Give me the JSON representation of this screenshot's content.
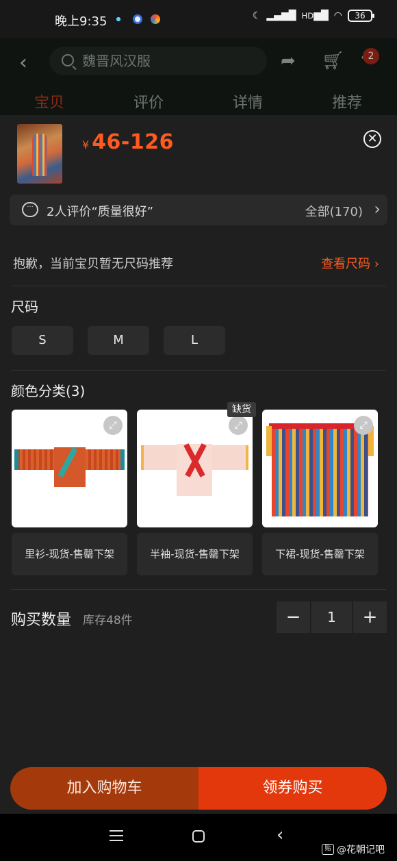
{
  "status_bar": {
    "time": "晚上9:35",
    "battery": "36",
    "network_label": "HD"
  },
  "header": {
    "search_placeholder": "魏晋风汉服",
    "cart_badge": "2",
    "tabs": [
      {
        "label": "宝贝",
        "active": true
      },
      {
        "label": "评价",
        "active": false
      },
      {
        "label": "详情",
        "active": false
      },
      {
        "label": "推荐",
        "active": false
      }
    ]
  },
  "sheet": {
    "price_currency": "¥",
    "price_range": "46-126",
    "review": {
      "text": "2人评价“质量很好”",
      "all_label": "全部(170)"
    },
    "size_notice": "抱歉，当前宝贝暂无尺码推荐",
    "view_size_label": "查看尺码",
    "size_title": "尺码",
    "sizes": [
      "S",
      "M",
      "L"
    ],
    "color_title": "颜色分类(3)",
    "colors": [
      {
        "label": "里衫-现货-售罄下架"
      },
      {
        "label": "半袖-现货-售罄下架",
        "tag": "缺货"
      },
      {
        "label": "下裙-现货-售罄下架"
      }
    ],
    "quantity_title": "购买数量",
    "stock_label": "库存48件",
    "quantity": "1",
    "add_to_cart_label": "加入购物车",
    "buy_label": "领券购买"
  },
  "watermark": {
    "icon": "贴",
    "text": "@花朝记吧"
  },
  "colors_theme": {
    "accent": "#ff5a1f",
    "buy": "#e3380b",
    "cart": "#a4390b",
    "background": "#1f1f1f"
  }
}
